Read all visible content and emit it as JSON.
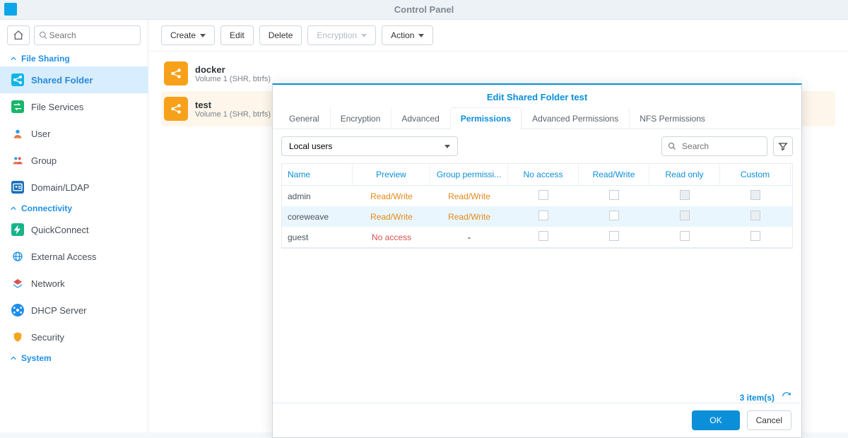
{
  "window_title": "Control Panel",
  "sidebar": {
    "search_placeholder": "Search",
    "sections": {
      "file_sharing": {
        "label": "File Sharing",
        "items": [
          {
            "label": "Shared Folder",
            "active": true
          },
          {
            "label": "File Services"
          },
          {
            "label": "User"
          },
          {
            "label": "Group"
          },
          {
            "label": "Domain/LDAP"
          }
        ]
      },
      "connectivity": {
        "label": "Connectivity",
        "items": [
          {
            "label": "QuickConnect"
          },
          {
            "label": "External Access"
          },
          {
            "label": "Network"
          },
          {
            "label": "DHCP Server"
          },
          {
            "label": "Security"
          }
        ]
      },
      "system": {
        "label": "System"
      }
    }
  },
  "toolbar": {
    "create": "Create",
    "edit": "Edit",
    "delete": "Delete",
    "encryption": "Encryption",
    "action": "Action"
  },
  "folders": [
    {
      "name": "docker",
      "location": "Volume 1 (SHR, btrfs)"
    },
    {
      "name": "test",
      "location": "Volume 1 (SHR, btrfs)",
      "selected": true
    }
  ],
  "modal": {
    "title": "Edit Shared Folder test",
    "tabs": [
      {
        "label": "General"
      },
      {
        "label": "Encryption"
      },
      {
        "label": "Advanced"
      },
      {
        "label": "Permissions",
        "active": true
      },
      {
        "label": "Advanced Permissions"
      },
      {
        "label": "NFS Permissions"
      }
    ],
    "user_scope": "Local users",
    "search_placeholder": "Search",
    "columns": {
      "name": "Name",
      "preview": "Preview",
      "group": "Group permissi...",
      "noaccess": "No access",
      "rw": "Read/Write",
      "ro": "Read only",
      "custom": "Custom"
    },
    "rows": [
      {
        "name": "admin",
        "preview": "Read/Write",
        "preview_cls": "rw",
        "group": "Read/Write",
        "group_cls": "rw",
        "highlight": false,
        "custom_disabled": true
      },
      {
        "name": "coreweave",
        "preview": "Read/Write",
        "preview_cls": "rw",
        "group": "Read/Write",
        "group_cls": "rw",
        "highlight": true,
        "custom_disabled": true
      },
      {
        "name": "guest",
        "preview": "No access",
        "preview_cls": "noacc",
        "group": "-",
        "group_cls": "",
        "highlight": false,
        "custom_disabled": false
      }
    ],
    "item_count": "3 item(s)",
    "ok": "OK",
    "cancel": "Cancel"
  }
}
